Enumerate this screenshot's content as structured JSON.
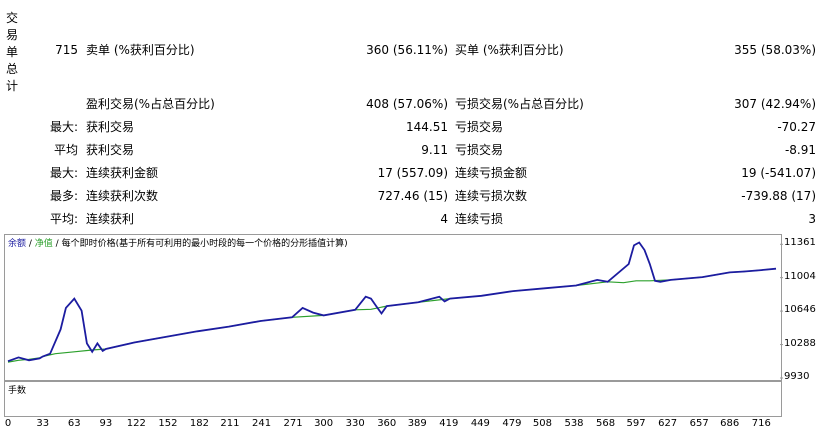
{
  "side_title": [
    "交",
    "易",
    "单",
    "总",
    "计"
  ],
  "summary": {
    "total": "715",
    "sell_label": "卖单 (%获利百分比)",
    "sell_value": "360 (56.11%)",
    "buy_label": "买单 (%获利百分比)",
    "buy_value": "355 (58.03%)",
    "profit_trades_label": "盈利交易(%占总百分比)",
    "profit_trades_value": "408 (57.06%)",
    "loss_trades_label": "亏损交易(%占总百分比)",
    "loss_trades_value": "307 (42.94%)"
  },
  "stats": [
    {
      "prefix": "最大:",
      "left_label": "获利交易",
      "left_value": "144.51",
      "right_label": "亏损交易",
      "right_value": "-70.27"
    },
    {
      "prefix": "平均",
      "left_label": "获利交易",
      "left_value": "9.11",
      "right_label": "亏损交易",
      "right_value": "-8.91"
    },
    {
      "prefix": "最大:",
      "left_label": "连续获利金额",
      "left_value": "17 (557.09)",
      "right_label": "连续亏损金额",
      "right_value": "19 (-541.07)"
    },
    {
      "prefix": "最多:",
      "left_label": "连续获利次数",
      "left_value": "727.46 (15)",
      "right_label": "连续亏损次数",
      "right_value": "-739.88 (17)"
    },
    {
      "prefix": "平均:",
      "left_label": "连续获利",
      "left_value": "4",
      "right_label": "连续亏损",
      "right_value": "3"
    }
  ],
  "chart_legend": {
    "balance": "余额",
    "sep1": " / ",
    "equity": "净值",
    "sep2": " / ",
    "desc": "每个即时价格(基于所有可利用的最小时段的每一个价格的分形插值计算)"
  },
  "lots_label": "手数",
  "colors": {
    "balance": "#1c1ca0",
    "equity": "#2ca02c",
    "lots": "#19b319"
  },
  "chart_data": {
    "type": "line",
    "series": [
      {
        "name": "余额",
        "x": [
          0,
          10,
          20,
          30,
          33,
          45,
          63,
          80,
          93,
          120,
          150,
          180,
          210,
          240,
          270,
          300,
          330,
          345,
          360,
          390,
          420,
          450,
          480,
          510,
          540,
          570,
          585,
          597,
          610,
          630,
          660,
          686,
          700,
          716,
          730
        ],
        "y": [
          10100,
          10120,
          10130,
          10145,
          10160,
          10190,
          10210,
          10230,
          10240,
          10310,
          10370,
          10430,
          10480,
          10540,
          10580,
          10600,
          10660,
          10665,
          10700,
          10740,
          10780,
          10810,
          10860,
          10890,
          10920,
          10960,
          10950,
          10970,
          10970,
          10980,
          11010,
          11060,
          11070,
          11085,
          11100
        ]
      },
      {
        "name": "净值",
        "x": [
          0,
          10,
          20,
          30,
          33,
          40,
          50,
          55,
          63,
          70,
          75,
          80,
          85,
          90,
          93,
          120,
          150,
          180,
          210,
          240,
          270,
          280,
          290,
          300,
          330,
          340,
          345,
          350,
          355,
          360,
          390,
          410,
          415,
          420,
          450,
          480,
          510,
          540,
          560,
          570,
          590,
          595,
          600,
          605,
          610,
          615,
          620,
          630,
          660,
          686,
          700,
          716,
          730
        ],
        "y": [
          10110,
          10150,
          10120,
          10140,
          10160,
          10190,
          10450,
          10680,
          10780,
          10650,
          10300,
          10210,
          10300,
          10220,
          10240,
          10310,
          10370,
          10430,
          10480,
          10540,
          10580,
          10680,
          10630,
          10600,
          10660,
          10800,
          10780,
          10700,
          10620,
          10700,
          10740,
          10800,
          10750,
          10780,
          10810,
          10860,
          10890,
          10920,
          10980,
          10960,
          11150,
          11350,
          11380,
          11300,
          11150,
          10970,
          10960,
          10980,
          11010,
          11060,
          11070,
          11085,
          11100
        ]
      }
    ],
    "yticks": [
      11361,
      11004,
      10646,
      10288,
      9930
    ],
    "xticks": [
      0,
      33,
      63,
      93,
      122,
      152,
      182,
      211,
      241,
      271,
      300,
      330,
      360,
      389,
      419,
      449,
      479,
      508,
      538,
      568,
      597,
      627,
      657,
      686,
      716
    ],
    "ylim": [
      9930,
      11450
    ],
    "xlim": [
      0,
      730
    ]
  }
}
